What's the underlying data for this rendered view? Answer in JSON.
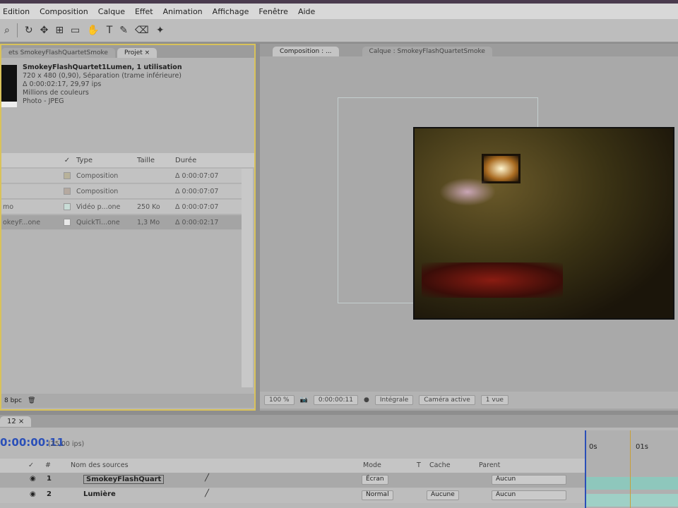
{
  "menu": [
    "Edition",
    "Composition",
    "Calque",
    "Effet",
    "Animation",
    "Affichage",
    "Fenêtre",
    "Aide"
  ],
  "toolbar_icons": [
    "zoom-icon",
    "rotate-icon",
    "camera-orbit-icon",
    "pan-behind-icon",
    "mask-icon",
    "hand-icon",
    "text-icon",
    "pen-icon",
    "eraser-icon",
    "puppet-icon"
  ],
  "project": {
    "tabs": [
      "ets SmokeyFlashQuartetSmoke",
      "Projet ×"
    ],
    "info": {
      "title": "SmokeyFlashQuartet1Lumen, 1 utilisation",
      "line1": "720 x 480 (0,90), Séparation (trame inférieure)",
      "line2": "Δ 0:00:02:17, 29,97 ips",
      "line3": "Millions de couleurs",
      "line4": "Photo - JPEG"
    },
    "headers": {
      "type": "Type",
      "size": "Taille",
      "duration": "Durée"
    },
    "rows": [
      {
        "name": "",
        "type": "Composition",
        "size": "",
        "duration": "Δ 0:00:07:07",
        "color": "#b8b29a"
      },
      {
        "name": "",
        "type": "Composition",
        "size": "",
        "duration": "Δ 0:00:07:07",
        "color": "#b5a9a0"
      },
      {
        "name": "mo",
        "type": "Vidéo p...one",
        "size": "250 Ko",
        "duration": "Δ 0:00:07:07",
        "color": "#c8dcd6"
      },
      {
        "name": "okeyF...one",
        "type": "QuickTi...one",
        "size": "1,3 Mo",
        "duration": "Δ 0:00:02:17",
        "color": "#e8e8e8"
      }
    ],
    "bpc": "8 bpc"
  },
  "comp": {
    "tabs": [
      "Composition : ...",
      "Calque : SmokeyFlashQuartetSmoke"
    ],
    "zoom": "100 %",
    "time": "0:00:00:11",
    "resolution": "Intégrale",
    "camera": "Caméra active",
    "views": "1 vue"
  },
  "timeline": {
    "tab": "12 ×",
    "time": "0:00:00:11",
    "fps": "(25,00 ips)",
    "headers": {
      "num": "#",
      "name": "Nom des sources",
      "mode": "Mode",
      "t": "T",
      "matte": "Cache",
      "parent": "Parent"
    },
    "layers": [
      {
        "num": "1",
        "name": "SmokeyFlashQuart",
        "mode": "Écran",
        "matte": "",
        "parent": "Aucun"
      },
      {
        "num": "2",
        "name": "Lumière",
        "mode": "Normal",
        "matte": "Aucune",
        "parent": "Aucun"
      }
    ],
    "ruler": [
      "0s",
      "01s"
    ]
  }
}
